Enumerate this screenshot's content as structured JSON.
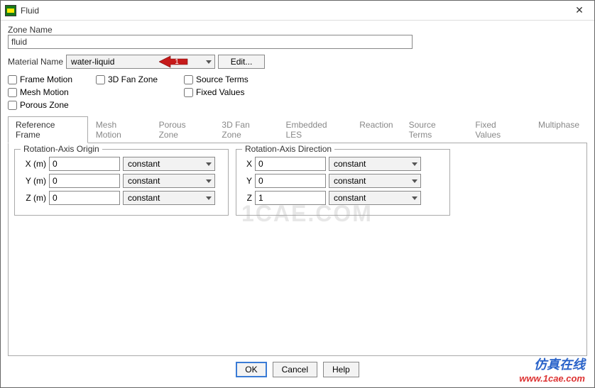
{
  "window": {
    "title": "Fluid"
  },
  "zone": {
    "label": "Zone Name",
    "value": "fluid"
  },
  "material": {
    "label": "Material Name",
    "value": "water-liquid",
    "edit": "Edit...",
    "annotation_number": "1"
  },
  "checks": {
    "frame_motion": "Frame Motion",
    "fan_zone": "3D Fan Zone",
    "source_terms": "Source Terms",
    "mesh_motion": "Mesh Motion",
    "fixed_values": "Fixed Values",
    "porous_zone": "Porous Zone"
  },
  "tabs": [
    "Reference Frame",
    "Mesh Motion",
    "Porous Zone",
    "3D Fan Zone",
    "Embedded LES",
    "Reaction",
    "Source Terms",
    "Fixed Values",
    "Multiphase"
  ],
  "origin": {
    "legend": "Rotation-Axis Origin",
    "rows": [
      {
        "label": "X (m)",
        "value": "0",
        "mode": "constant"
      },
      {
        "label": "Y (m)",
        "value": "0",
        "mode": "constant"
      },
      {
        "label": "Z (m)",
        "value": "0",
        "mode": "constant"
      }
    ]
  },
  "direction": {
    "legend": "Rotation-Axis Direction",
    "rows": [
      {
        "label": "X",
        "value": "0",
        "mode": "constant"
      },
      {
        "label": "Y",
        "value": "0",
        "mode": "constant"
      },
      {
        "label": "Z",
        "value": "1",
        "mode": "constant"
      }
    ]
  },
  "buttons": {
    "ok": "OK",
    "cancel": "Cancel",
    "help": "Help"
  },
  "watermark": "1CAE.COM",
  "brand": {
    "cn": "仿真在线",
    "url": "www.1cae.com"
  }
}
